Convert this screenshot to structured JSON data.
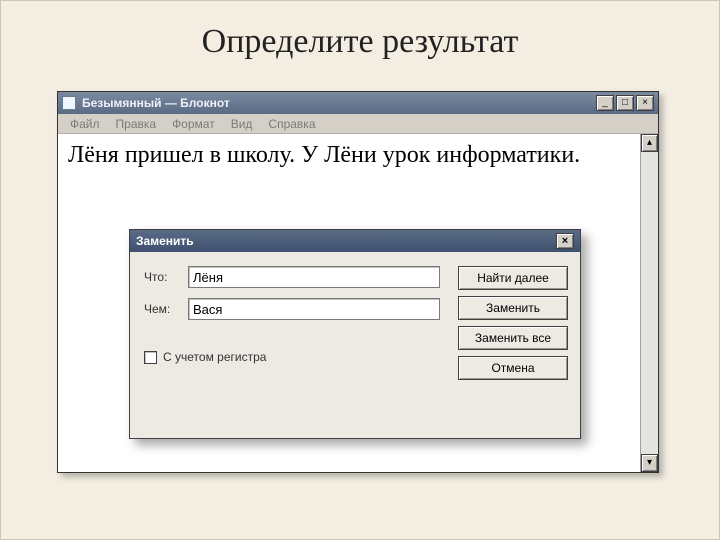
{
  "slide": {
    "title": "Определите результат"
  },
  "notepad": {
    "window_title": "Безымянный — Блокнот",
    "menu": {
      "file": "Файл",
      "edit": "Правка",
      "format": "Формат",
      "view": "Вид",
      "help": "Справка"
    },
    "text": "Лёня пришел в школу. У Лёни урок информатики.",
    "win_btns": {
      "min": "_",
      "max": "□",
      "close": "×"
    },
    "scroll": {
      "up": "▴",
      "down": "▾"
    }
  },
  "dialog": {
    "title": "Заменить",
    "close_glyph": "×",
    "what_label": "Что:",
    "what_value": "Лёня",
    "with_label": "Чем:",
    "with_value": "Вася",
    "case_label": "С учетом регистра",
    "buttons": {
      "find_next": "Найти далее",
      "replace": "Заменить",
      "replace_all": "Заменить все",
      "cancel": "Отмена"
    }
  }
}
